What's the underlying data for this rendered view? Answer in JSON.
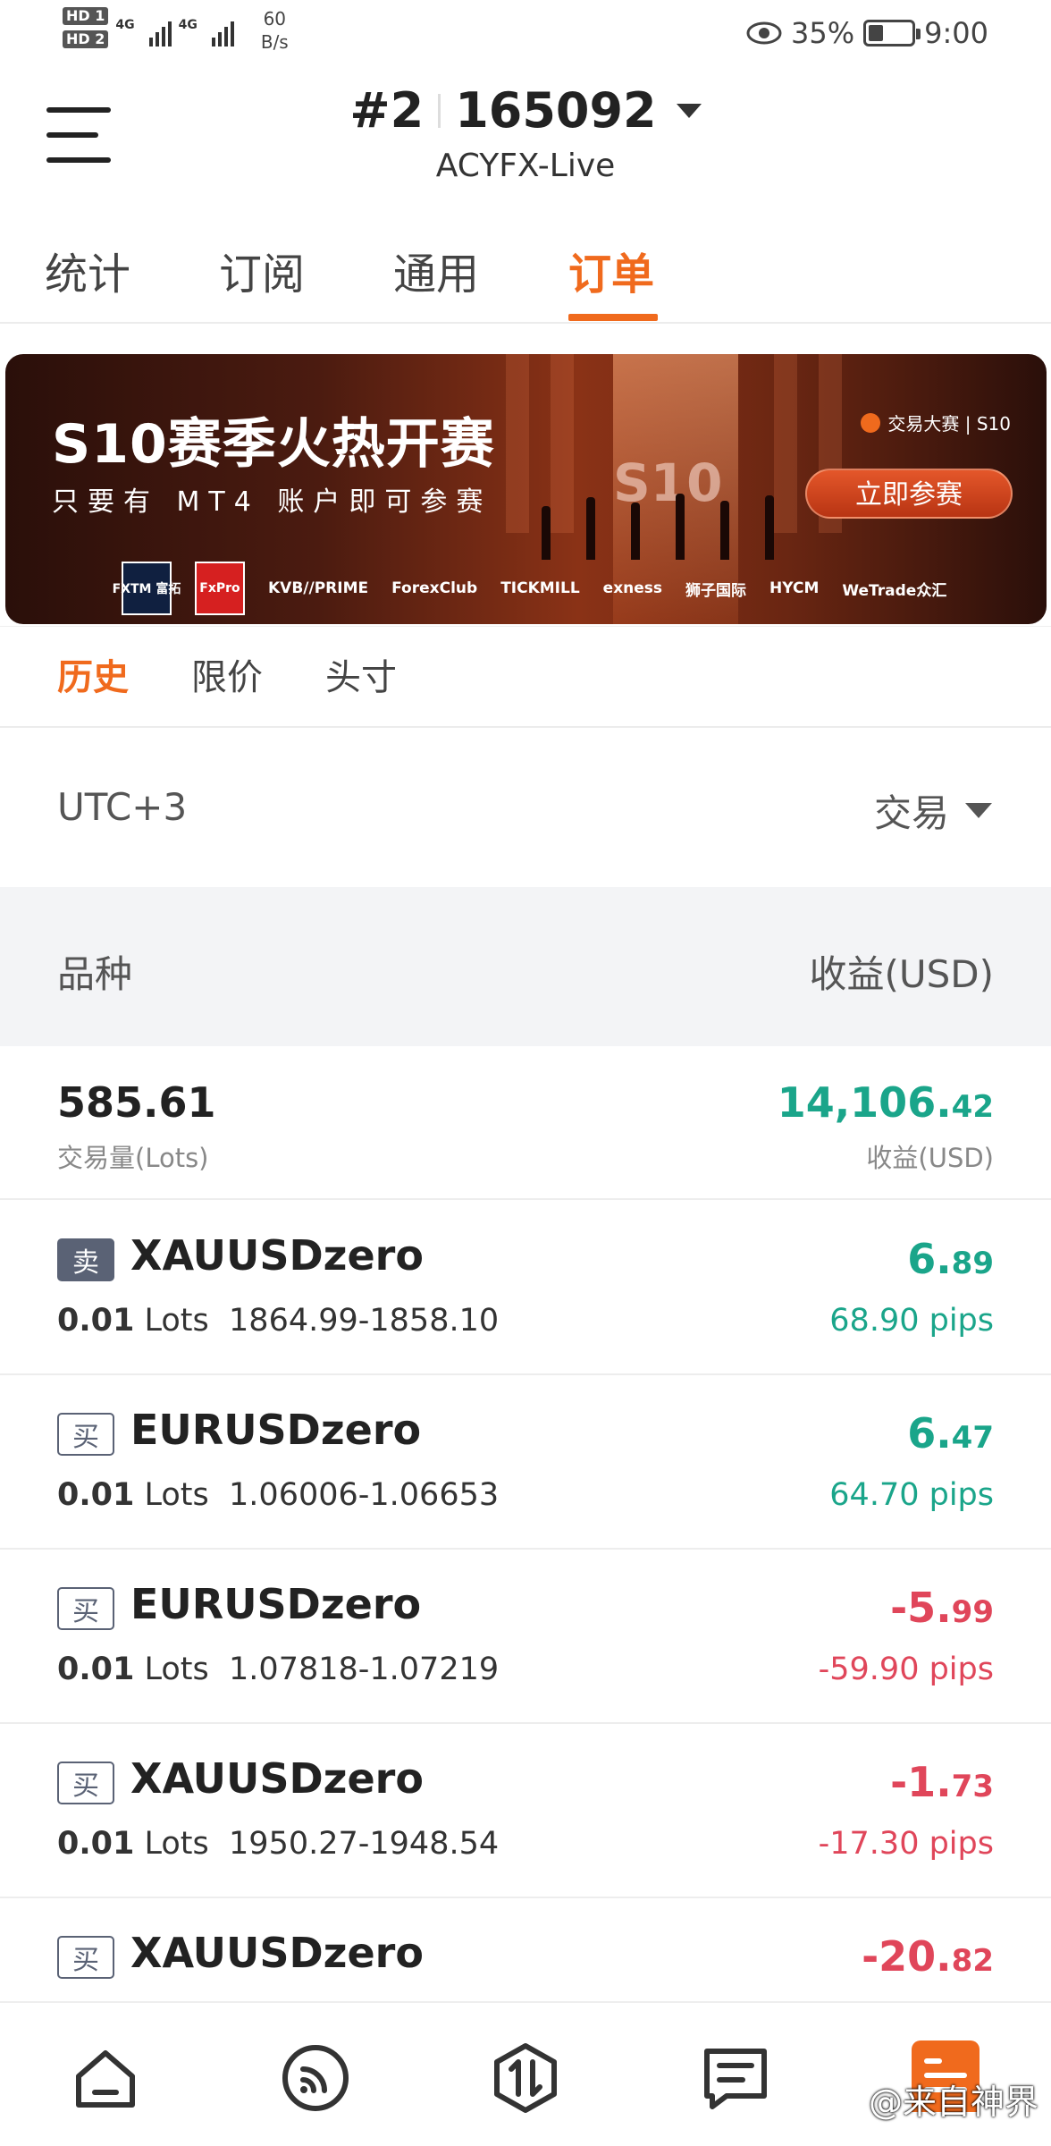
{
  "status_bar": {
    "sim1": "HD 1",
    "sim2": "HD 2",
    "net1": "4G",
    "net2": "4G",
    "speed_value": "60",
    "speed_unit": "B/s",
    "battery": "35%",
    "battery_level": 0.35,
    "time": "9:00"
  },
  "header": {
    "account_index": "#2",
    "account_number": "165092",
    "server": "ACYFX-Live"
  },
  "tabs": [
    {
      "label": "统计",
      "active": false
    },
    {
      "label": "订阅",
      "active": false
    },
    {
      "label": "通用",
      "active": false
    },
    {
      "label": "订单",
      "active": true
    }
  ],
  "banner": {
    "title": "S10赛季火热开赛",
    "subtitle": "只要有 MT4 账户即可参赛",
    "badge": "交易大赛 | S10",
    "season_mark": "S10",
    "cta": "立即参赛",
    "sponsors": [
      "FXTM 富拓",
      "FxPro",
      "KVB//PRIME",
      "ForexClub",
      "TICKMILL",
      "exness",
      "狮子国际",
      "HYCM",
      "WeTrade众汇"
    ]
  },
  "order_tabs": [
    {
      "label": "历史",
      "active": true
    },
    {
      "label": "限价",
      "active": false
    },
    {
      "label": "头寸",
      "active": false
    }
  ],
  "filter": {
    "timezone": "UTC+3",
    "type": "交易"
  },
  "table_header": {
    "symbol": "品种",
    "profit": "收益(USD)"
  },
  "summary": {
    "lots": "585.61",
    "lots_label": "交易量(Lots)",
    "profit_main": "14,106.",
    "profit_cents": "42",
    "profit_label": "收益(USD)"
  },
  "orders": [
    {
      "side": "卖",
      "side_type": "sell",
      "symbol": "XAUUSDzero",
      "lots": "0.01",
      "lots_unit": "Lots",
      "prices": "1864.99-1858.10",
      "profit_main": "6.",
      "profit_cents": "89",
      "pips": "68.90 pips",
      "sign": "pos"
    },
    {
      "side": "买",
      "side_type": "buy",
      "symbol": "EURUSDzero",
      "lots": "0.01",
      "lots_unit": "Lots",
      "prices": "1.06006-1.06653",
      "profit_main": "6.",
      "profit_cents": "47",
      "pips": "64.70 pips",
      "sign": "pos"
    },
    {
      "side": "买",
      "side_type": "buy",
      "symbol": "EURUSDzero",
      "lots": "0.01",
      "lots_unit": "Lots",
      "prices": "1.07818-1.07219",
      "profit_main": "-5.",
      "profit_cents": "99",
      "pips": "-59.90 pips",
      "sign": "neg"
    },
    {
      "side": "买",
      "side_type": "buy",
      "symbol": "XAUUSDzero",
      "lots": "0.01",
      "lots_unit": "Lots",
      "prices": "1950.27-1948.54",
      "profit_main": "-1.",
      "profit_cents": "73",
      "pips": "-17.30 pips",
      "sign": "neg"
    },
    {
      "side": "买",
      "side_type": "buy",
      "symbol": "XAUUSDzero",
      "lots": "",
      "lots_unit": "",
      "prices": "",
      "profit_main": "-20.",
      "profit_cents": "82",
      "pips": "",
      "sign": "neg"
    }
  ],
  "bottom_nav": {
    "items": [
      "home-icon",
      "feed-icon",
      "trade-icon",
      "orders-icon",
      "profile-icon"
    ],
    "watermark": "@来自神界"
  },
  "colors": {
    "accent": "#f06a1d",
    "profit": "#1aa58a",
    "loss": "#e0465a"
  }
}
